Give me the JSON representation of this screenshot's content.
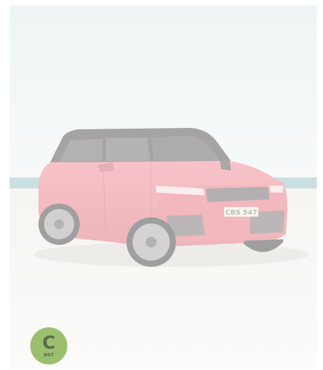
{
  "vehicle": {
    "plate": "CBS 547"
  },
  "energy_badge": {
    "rating": "C",
    "authority": "DGT",
    "color": "#9bbf6f"
  },
  "colors": {
    "car_body": "#e86b78",
    "sky_top": "#d9e7ea",
    "sea": "#7fb0ba",
    "sand": "#efece6"
  }
}
